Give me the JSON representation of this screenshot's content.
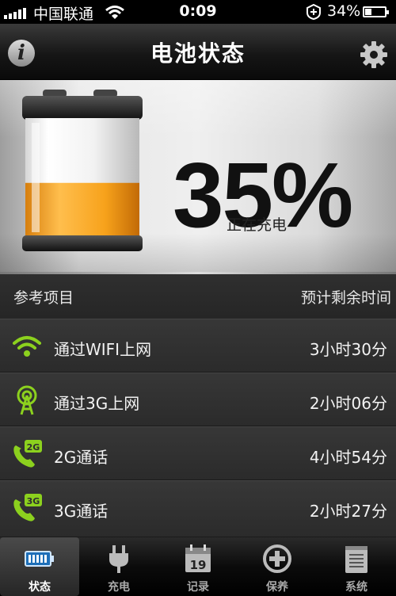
{
  "status_bar": {
    "carrier": "中国联通",
    "time": "0:09",
    "battery_percent": "34%",
    "battery_level": 0.34,
    "signal_bars": 5
  },
  "nav": {
    "title": "电池状态",
    "info_icon": "info-icon",
    "settings_icon": "gear-icon"
  },
  "battery": {
    "percent": "35%",
    "level": 0.35,
    "status": "正在充电",
    "fill_color": "#f7a21b"
  },
  "list": {
    "header_left": "参考项目",
    "header_right": "预计剩余时间",
    "items": [
      {
        "label": "通过WIFI上网",
        "value": "3小时30分",
        "icon": "wifi-icon"
      },
      {
        "label": "通过3G上网",
        "value": "2小时06分",
        "icon": "antenna-icon"
      },
      {
        "label": "2G通话",
        "value": "4小时54分",
        "icon": "phone-2g-icon",
        "badge": "2G"
      },
      {
        "label": "3G通话",
        "value": "2小时27分",
        "icon": "phone-3g-icon",
        "badge": "3G"
      }
    ],
    "accent_color": "#8cd11e"
  },
  "tabs": [
    {
      "label": "状态",
      "icon": "battery-icon",
      "active": true
    },
    {
      "label": "充电",
      "icon": "plug-icon",
      "active": false
    },
    {
      "label": "记录",
      "icon": "calendar-icon",
      "active": false,
      "day": "19"
    },
    {
      "label": "保养",
      "icon": "plus-circle-icon",
      "active": false
    },
    {
      "label": "系统",
      "icon": "notepad-icon",
      "active": false
    }
  ]
}
